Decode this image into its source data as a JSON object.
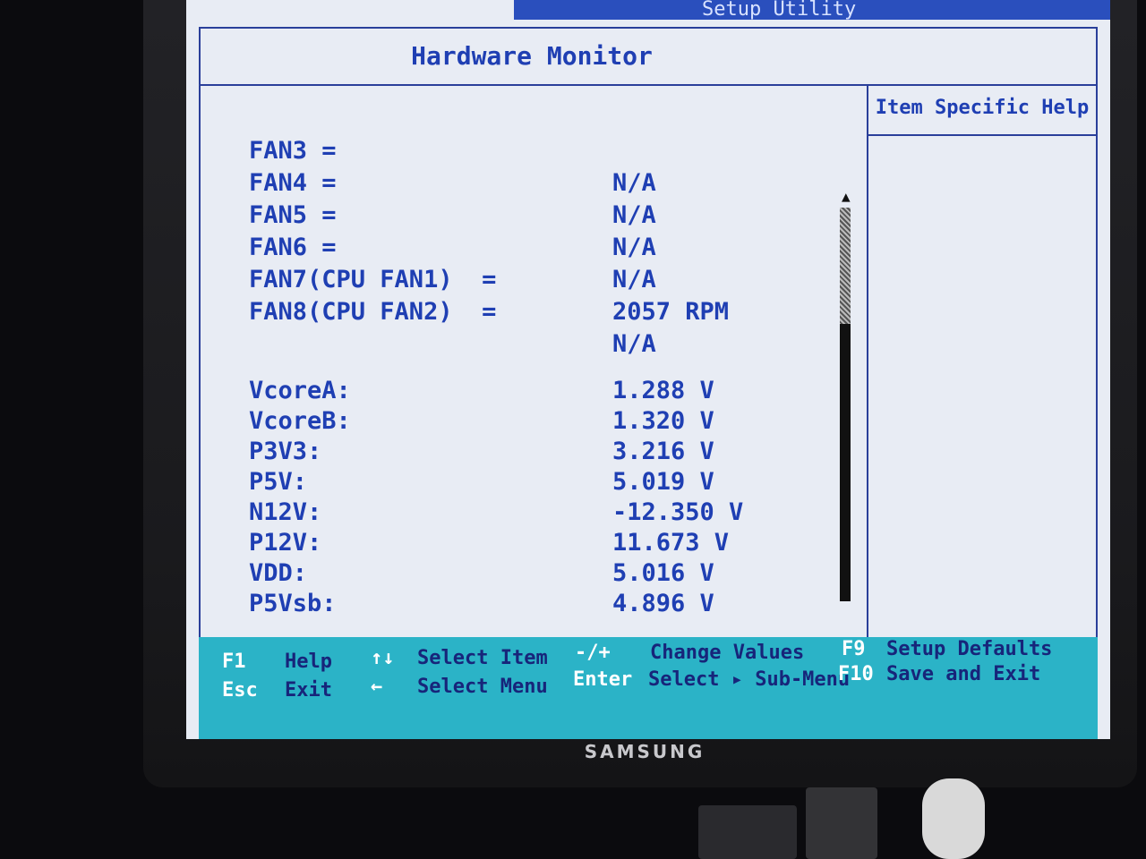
{
  "window": {
    "title_fragment": "Setup Utility",
    "page_title": "Hardware Monitor"
  },
  "help_panel": {
    "title": "Item Specific Help"
  },
  "monitor": {
    "fans": [
      {
        "label": "FAN3 =",
        "value": ""
      },
      {
        "label": "FAN4 =",
        "value": "N/A"
      },
      {
        "label": "FAN5 =",
        "value": "N/A"
      },
      {
        "label": "FAN6 =",
        "value": "N/A"
      },
      {
        "label": "FAN7(CPU FAN1)  =",
        "value": "N/A"
      },
      {
        "label": "FAN8(CPU FAN2)  =",
        "value": "2057 RPM"
      },
      {
        "label": "",
        "value": "N/A"
      }
    ],
    "voltages": [
      {
        "label": "VcoreA:",
        "value": "1.288 V"
      },
      {
        "label": "VcoreB:",
        "value": "1.320 V"
      },
      {
        "label": "P3V3:",
        "value": "3.216 V"
      },
      {
        "label": "P5V:",
        "value": "5.019 V"
      },
      {
        "label": "N12V:",
        "value": "-12.350 V"
      },
      {
        "label": "P12V:",
        "value": "11.673 V"
      },
      {
        "label": "VDD:",
        "value": "5.016 V"
      },
      {
        "label": "P5Vsb:",
        "value": "4.896 V"
      }
    ]
  },
  "footer": {
    "f1_key": "F1",
    "f1_desc": "Help",
    "updown_key": "↑↓",
    "updown_desc": "Select Item",
    "esc_key": "Esc",
    "esc_desc": "Exit",
    "leftright_key": "←",
    "leftright_desc": "Select Menu",
    "plusminus_key": "-/+",
    "plusminus_desc": "Change Values",
    "enter_key": "Enter",
    "enter_desc": "Select ▸ Sub-Menu",
    "f9_key": "F9",
    "f9_desc": "Setup Defaults",
    "f10_key": "F10",
    "f10_desc": "Save and Exit"
  },
  "monitor_brand": "SAMSUNG",
  "colors": {
    "screen_bg": "#e8ecf4",
    "text_blue": "#1f3fb3",
    "footer_cyan": "#2bb3c7"
  }
}
